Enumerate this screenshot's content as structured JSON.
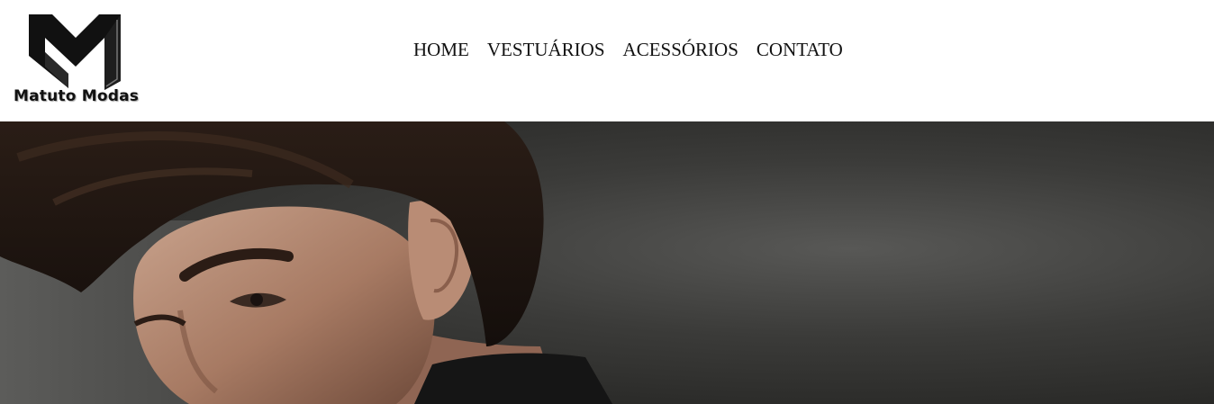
{
  "brand": {
    "name": "Matuto Modas",
    "logo_icon": "em-monogram-logo"
  },
  "nav": {
    "items": [
      {
        "label": "HOME"
      },
      {
        "label": "VESTUÁRIOS"
      },
      {
        "label": "ACESSÓRIOS"
      },
      {
        "label": "CONTATO"
      }
    ]
  },
  "hero": {
    "image": "male-model-portrait",
    "background_color": "#3b3b39"
  }
}
